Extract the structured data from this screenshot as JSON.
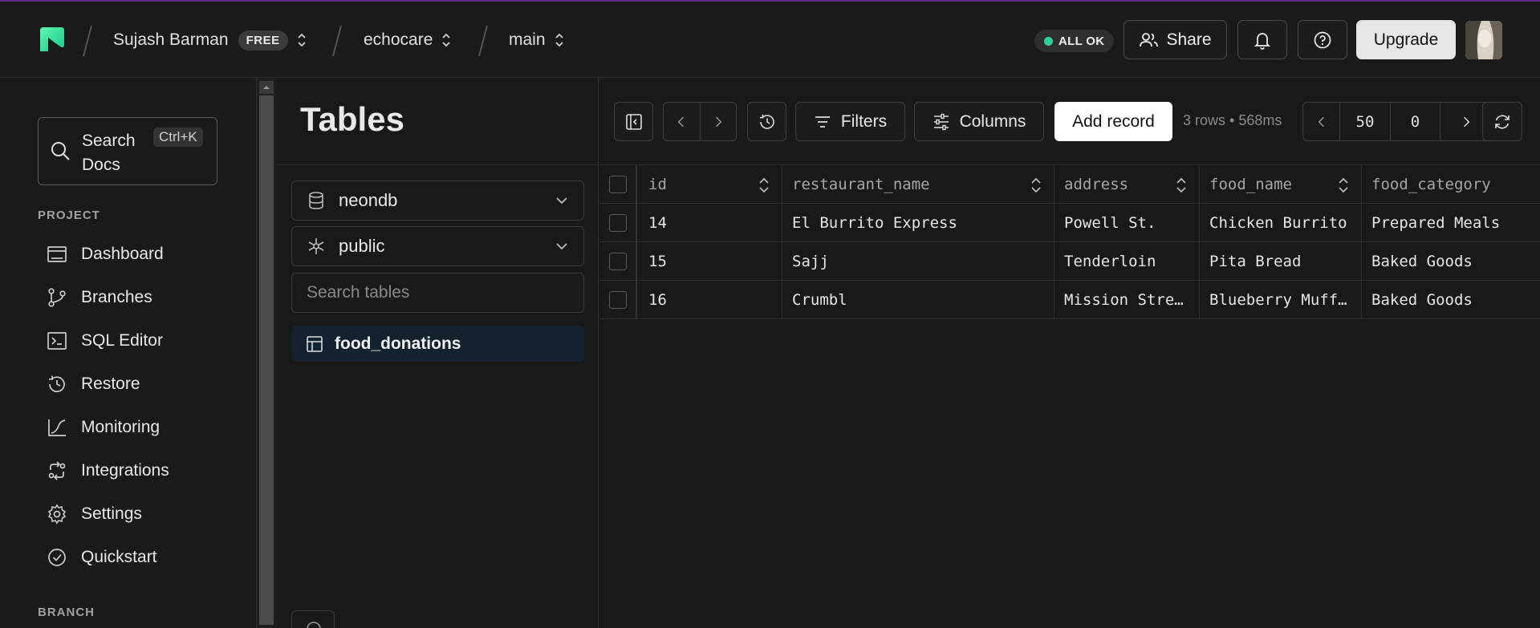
{
  "header": {
    "org_name": "Sujash Barman",
    "plan_badge": "FREE",
    "project_name": "echocare",
    "branch_name": "main",
    "status": "ALL OK",
    "share_label": "Share",
    "upgrade_label": "Upgrade"
  },
  "sidebar": {
    "search_label": "Search Docs",
    "search_shortcut": "Ctrl+K",
    "project_section": "PROJECT",
    "branch_section": "BRANCH",
    "items": [
      {
        "label": "Dashboard",
        "icon": "dashboard-icon"
      },
      {
        "label": "Branches",
        "icon": "branches-icon"
      },
      {
        "label": "SQL Editor",
        "icon": "sql-editor-icon"
      },
      {
        "label": "Restore",
        "icon": "restore-icon"
      },
      {
        "label": "Monitoring",
        "icon": "monitoring-icon"
      },
      {
        "label": "Integrations",
        "icon": "integrations-icon"
      },
      {
        "label": "Settings",
        "icon": "settings-icon"
      },
      {
        "label": "Quickstart",
        "icon": "quickstart-icon"
      }
    ]
  },
  "tables_panel": {
    "title": "Tables",
    "database": "neondb",
    "schema": "public",
    "search_placeholder": "Search tables",
    "selected_table": "food_donations"
  },
  "toolbar": {
    "filters_label": "Filters",
    "columns_label": "Columns",
    "add_record_label": "Add record",
    "rows_info": "3 rows • 568ms",
    "page_size": "50",
    "offset": "0"
  },
  "grid": {
    "columns": [
      "id",
      "restaurant_name",
      "address",
      "food_name",
      "food_category"
    ],
    "rows": [
      [
        "14",
        "El Burrito Express",
        "Powell St.",
        "Chicken Burrito",
        "Prepared Meals"
      ],
      [
        "15",
        "Sajj",
        "Tenderloin",
        "Pita Bread",
        "Baked Goods"
      ],
      [
        "16",
        "Crumbl",
        "Mission Stre…",
        "Blueberry Muff…",
        "Baked Goods"
      ]
    ]
  },
  "colors": {
    "accent_green": "#2ed39a",
    "top_border": "#5b2a86",
    "selected_table_bg": "#14222f"
  }
}
